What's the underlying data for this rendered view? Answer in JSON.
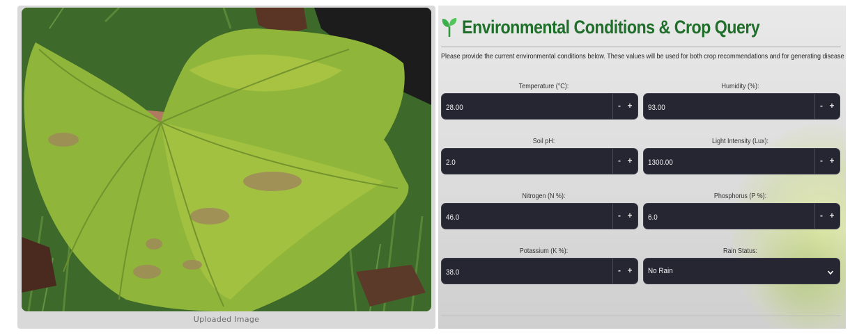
{
  "image_panel": {
    "caption": "Uploaded Image"
  },
  "form": {
    "icon": "sprout-icon",
    "title": "Environmental Conditions & Crop Query",
    "title_color": "#1f6f2b",
    "description": "Please provide the current environmental conditions below. These values will be used for both crop recommendations and for generating disease remedies.",
    "fields": [
      {
        "label": "Temperature (°C):",
        "value": "28.00",
        "type": "number"
      },
      {
        "label": "Humidity (%):",
        "value": "93.00",
        "type": "number"
      },
      {
        "label": "Soil pH:",
        "value": "2.0",
        "type": "number"
      },
      {
        "label": "Light Intensity (Lux):",
        "value": "1300.00",
        "type": "number"
      },
      {
        "label": "Nitrogen (N %):",
        "value": "46.0",
        "type": "number"
      },
      {
        "label": "Phosphorus (P %):",
        "value": "6.0",
        "type": "number"
      },
      {
        "label": "Potassium (K %):",
        "value": "38.0",
        "type": "number"
      },
      {
        "label": "Rain Status:",
        "value": "No Rain",
        "type": "select"
      }
    ],
    "stepper": {
      "minus": "-",
      "plus": "+"
    },
    "input_bg": "#262633"
  }
}
